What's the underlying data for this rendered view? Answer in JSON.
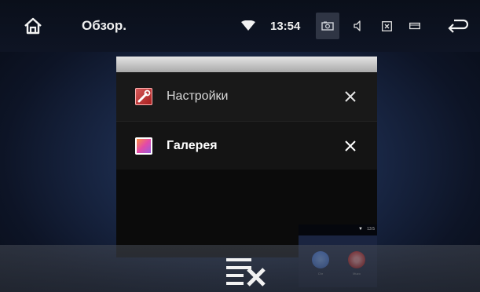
{
  "status_bar": {
    "title": "Обзор.",
    "time": "13:54",
    "icons": [
      "home-icon",
      "wifi-icon",
      "screenshot-icon",
      "volume-icon",
      "close-window-icon",
      "window-icon",
      "back-icon"
    ]
  },
  "recents": {
    "cards": [
      {
        "label": "Настройки",
        "icon": "settings-app-icon"
      },
      {
        "label": "Галерея",
        "icon": "gallery-app-icon"
      }
    ],
    "thumbnail": {
      "time": "13:5",
      "apps": [
        "Chr",
        "Muzo"
      ]
    }
  },
  "bottom_bar": {
    "clear_all_icon": "clear-all-icon"
  },
  "colors": {
    "background": "#1b2a4a",
    "card": "#191919",
    "accent_red": "#c42121"
  }
}
